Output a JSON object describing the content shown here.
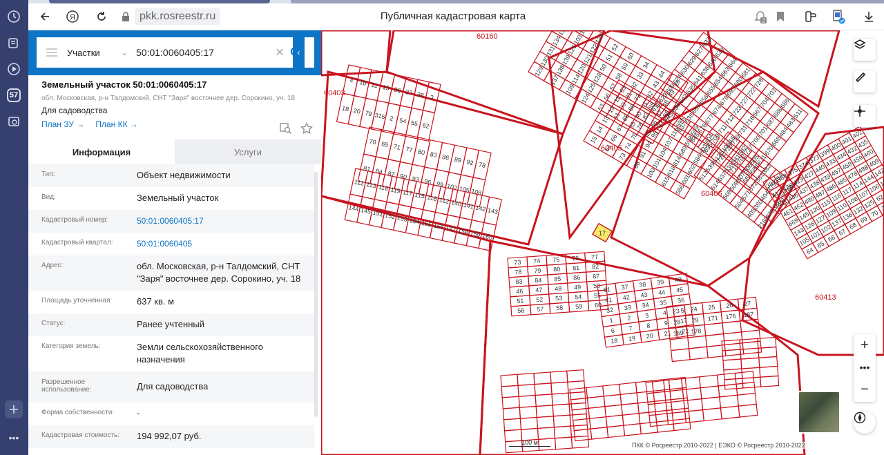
{
  "browser": {
    "url": "pkk.rosreestr.ru",
    "page_title": "Публичная кадастровая карта",
    "rail_badge": "57",
    "notification_count": "2"
  },
  "search": {
    "type_label": "Участки",
    "query": "50:01:0060405:17"
  },
  "object": {
    "title": "Земельный участок 50:01:0060405:17",
    "address_short": "обл. Московская, р-н Талдомский, СНТ \"Заря\" восточнее дер. Сорокино, уч. 18",
    "use": "Для садоводства",
    "link_plan_zu": "План ЗУ →",
    "link_plan_kk": "План КК →"
  },
  "tabs": [
    {
      "label": "Информация"
    },
    {
      "label": "Услуги"
    }
  ],
  "properties": [
    {
      "key": "Тип:",
      "value": "Объект недвижимости"
    },
    {
      "key": "Вид:",
      "value": "Земельный участок"
    },
    {
      "key": "Кадастровый номер:",
      "value": "50:01:0060405:17"
    },
    {
      "key": "Кадастровый квартал:",
      "value": "50:01:0060405"
    },
    {
      "key": "Адрес:",
      "value": "обл. Московская, р-н Талдомский, СНТ \"Заря\" восточнее дер. Сорокино, уч. 18"
    },
    {
      "key": "Площадь уточненная:",
      "value": "637 кв. м"
    },
    {
      "key": "Статус:",
      "value": "Ранее учтенный"
    },
    {
      "key": "Категория земель:",
      "value": "Земли сельскохозяйственного назначения"
    },
    {
      "key": "Разрешенное использование:",
      "value": "Для садоводства"
    },
    {
      "key": "Форма собственности:",
      "value": "-"
    },
    {
      "key": "Кадастровая стоимость:",
      "value": "194 992,07 руб."
    }
  ],
  "map": {
    "block_labels": [
      "60405",
      "60406",
      "60413",
      "60160",
      "60403"
    ],
    "parcel_numbers": [
      "4",
      "10",
      "11",
      "15",
      "36",
      "37",
      "38",
      "3",
      "18",
      "20",
      "79",
      "315",
      "2",
      "54",
      "55",
      "62",
      "70",
      "65",
      "71",
      "77",
      "80",
      "83",
      "86",
      "89",
      "92",
      "78",
      "81",
      "84",
      "87",
      "90",
      "93",
      "96",
      "99",
      "102",
      "105",
      "108",
      "111",
      "113",
      "116",
      "119",
      "117",
      "115",
      "118",
      "112",
      "140",
      "141",
      "142",
      "143",
      "144",
      "145",
      "151",
      "152",
      "153",
      "154",
      "155",
      "156",
      "157",
      "158",
      "159",
      "160",
      "129",
      "130",
      "131",
      "134",
      "135",
      "136",
      "137",
      "138",
      "139",
      "126",
      "103",
      "106",
      "109",
      "114",
      "120",
      "121",
      "122",
      "123",
      "124",
      "125",
      "128",
      "50",
      "51",
      "52",
      "53",
      "56",
      "57",
      "58",
      "59",
      "60",
      "61",
      "30",
      "31",
      "32",
      "33",
      "34",
      "35",
      "40",
      "41",
      "42",
      "43",
      "44",
      "45",
      "46",
      "47",
      "48",
      "49",
      "16",
      "15",
      "14",
      "13",
      "12",
      "11",
      "63",
      "64",
      "66",
      "67",
      "68",
      "69",
      "72",
      "73",
      "74",
      "75",
      "76",
      "82",
      "85",
      "88",
      "91",
      "94",
      "95",
      "97",
      "98",
      "100",
      "101",
      "104",
      "107",
      "110",
      "595",
      "615",
      "618",
      "614",
      "589",
      "598",
      "599",
      "586",
      "601",
      "602",
      "584",
      "603",
      "604",
      "611",
      "623",
      "609",
      "624",
      "630",
      "629",
      "627",
      "633",
      "643",
      "634",
      "642",
      "635",
      "641",
      "636",
      "640",
      "639",
      "637",
      "638",
      "657",
      "658",
      "655",
      "654",
      "663",
      "664",
      "645",
      "676",
      "677",
      "674",
      "678",
      "693",
      "680",
      "681",
      "695",
      "709",
      "711",
      "712",
      "723",
      "727",
      "722",
      "728",
      "721",
      "729",
      "719",
      "731",
      "718",
      "567",
      "704",
      "703",
      "716",
      "702",
      "717",
      "700",
      "701",
      "687",
      "686",
      "688",
      "683",
      "684",
      "671",
      "670",
      "668",
      "484",
      "483",
      "511",
      "512",
      "539",
      "513",
      "510",
      "515",
      "514",
      "537",
      "538",
      "541",
      "542",
      "508",
      "509",
      "507",
      "506",
      "505",
      "504",
      "571",
      "572",
      "381",
      "382",
      "405",
      "380",
      "404",
      "379",
      "384",
      "2169",
      "378",
      "385",
      "377",
      "386",
      "387",
      "388",
      "375",
      "374",
      "373",
      "399",
      "400",
      "401",
      "402",
      "412",
      "428",
      "429",
      "427",
      "440",
      "433",
      "434",
      "432",
      "435",
      "431",
      "436",
      "437",
      "438",
      "439",
      "457",
      "458",
      "459",
      "460",
      "461",
      "462",
      "480",
      "487",
      "486",
      "485",
      "478",
      "488",
      "409",
      "669",
      "145",
      "120",
      "115",
      "116",
      "117",
      "114",
      "144",
      "142",
      "143",
      "126",
      "127",
      "109",
      "110",
      "108",
      "107",
      "106",
      "104",
      "105",
      "101",
      "102",
      "137",
      "136",
      "132",
      "125",
      "62",
      "63",
      "64",
      "65",
      "66",
      "67",
      "68",
      "69",
      "70",
      "71",
      "72",
      "73",
      "74",
      "75",
      "76",
      "77",
      "78",
      "79",
      "80",
      "81",
      "82",
      "83",
      "84",
      "85",
      "86",
      "87",
      "46",
      "47",
      "48",
      "49",
      "50",
      "51",
      "52",
      "53",
      "54",
      "55",
      "56",
      "57",
      "58",
      "59",
      "60",
      "61",
      "37",
      "38",
      "39",
      "40",
      "41",
      "42",
      "43",
      "44",
      "45",
      "32",
      "33",
      "34",
      "35",
      "36",
      "1",
      "2",
      "3",
      "4",
      "5",
      "6",
      "7",
      "8",
      "9",
      "17",
      "18",
      "19",
      "20",
      "21",
      "22",
      "23",
      "24",
      "25",
      "26",
      "27",
      "28",
      "29",
      "171",
      "176",
      "187",
      "169",
      "178"
    ],
    "highlighted_parcel": "17",
    "scale_label": "100 м",
    "footer": "ПКК © Росреестр 2010-2022 | ЕЭКО © Росреестр 2010-2022",
    "accent_color": "#c8141e",
    "highlight_color": "#f6e96b"
  },
  "colors": {
    "rail": "#35406e",
    "header_blue": "#0e74c5",
    "link": "#0e74c5"
  }
}
